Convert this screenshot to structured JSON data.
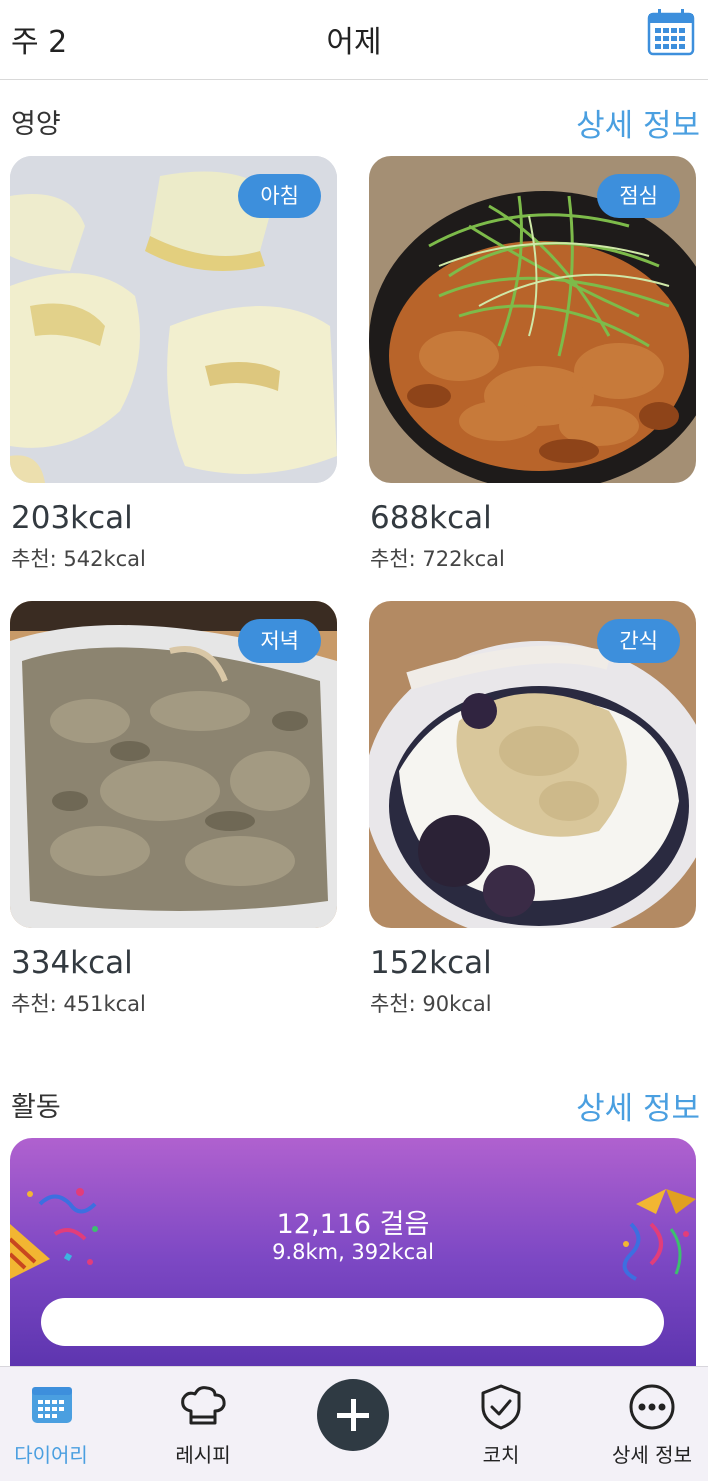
{
  "header": {
    "week": "주 2",
    "day": "어제",
    "calendar_icon": "calendar-icon"
  },
  "nutrition": {
    "title": "영양",
    "detail_link": "상세 정보",
    "meals": [
      {
        "badge": "아침",
        "kcal": "203kcal",
        "recommended": "추천: 542kcal",
        "photo": "apple-slices"
      },
      {
        "badge": "점심",
        "kcal": "688kcal",
        "recommended": "추천: 722kcal",
        "photo": "stir-fried-pork-with-scallions"
      },
      {
        "badge": "저녁",
        "kcal": "334kcal",
        "recommended": "추천: 451kcal",
        "photo": "oatmeal-porridge"
      },
      {
        "badge": "간식",
        "kcal": "152kcal",
        "recommended": "추천: 90kcal",
        "photo": "yogurt-with-berries-and-powder"
      }
    ]
  },
  "activity": {
    "title": "활동",
    "detail_link": "상세 정보",
    "steps": "12,116 걸음",
    "summary": "9.8km, 392kcal",
    "progress": 1.0
  },
  "tabbar": {
    "items": [
      {
        "label": "다이어리",
        "icon": "calendar-icon",
        "active": true
      },
      {
        "label": "레시피",
        "icon": "chef-hat-icon",
        "active": false
      },
      {
        "label": "",
        "icon": "plus-icon",
        "active": false
      },
      {
        "label": "코치",
        "icon": "shield-check-icon",
        "active": false
      },
      {
        "label": "상세 정보",
        "icon": "more-icon",
        "active": false
      }
    ]
  },
  "colors": {
    "accent": "#4a9fe0",
    "badge": "#3d8fdc",
    "activity_gradient_top": "#b061cf",
    "activity_gradient_bottom": "#5a33ad",
    "add_button": "#2f3a43"
  }
}
